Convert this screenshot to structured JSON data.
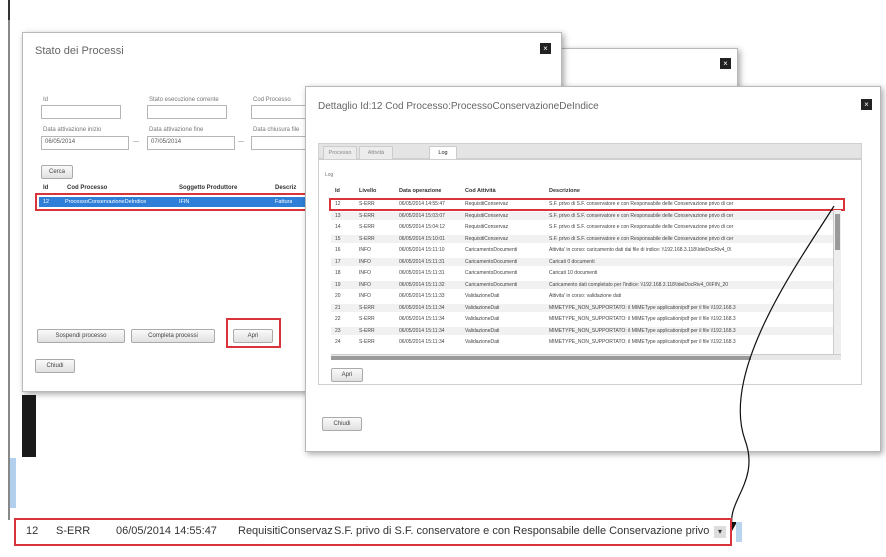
{
  "main_dialog": {
    "title": "Stato dei Processi",
    "close": "×",
    "fields": {
      "id_label": "Id",
      "stato_label": "Stato esecuzione corrente",
      "cod_label": "Cod Processo",
      "data_inizio_label": "Data attivazione inizio",
      "data_inizio_value": "06/05/2014",
      "data_fine_label": "Data attivazione fine",
      "data_fine_value": "07/05/2014",
      "data_chiusura_label": "Data chiusura file"
    },
    "search_button": "Cerca",
    "table": {
      "headers": [
        "Id",
        "Cod Processo",
        "Soggetto Produttore",
        "Descriz"
      ],
      "selected_row": [
        "12",
        "ProcessoConservazioneDeIndice",
        "IFIN",
        "Fattura"
      ]
    },
    "buttons": {
      "suspend": "Sospendi processo",
      "complete": "Completa processi",
      "open": "Apri",
      "close": "Chiudi"
    }
  },
  "detail_dialog": {
    "title": "Dettaglio Id:12 Cod Processo:ProcessoConservazioneDeIndice",
    "close": "×",
    "tabs": [
      "Processo",
      "Attività",
      "Log"
    ],
    "active_tab": "Log",
    "section_label": "Log",
    "headers": [
      "Id",
      "Livello",
      "Data operazione",
      "Cod Attività",
      "Descrizione"
    ],
    "rows": [
      [
        "12",
        "S-ERR",
        "06/05/2014 14:55:47",
        "RequisitiConservaz",
        "S.F. privo di S.F. conservatore e con Responsabile delle Conservazione privo di cer"
      ],
      [
        "13",
        "S-ERR",
        "06/05/2014 15:03:07",
        "RequisitiConservaz",
        "S.F. privo di S.F. conservatore e con Responsabile delle Conservazione privo di cer"
      ],
      [
        "14",
        "S-ERR",
        "06/05/2014 15:04:12",
        "RequisitiConservaz",
        "S.F. privo di S.F. conservatore e con Responsabile delle Conservazione privo di cer"
      ],
      [
        "15",
        "S-ERR",
        "06/05/2014 15:10:01",
        "RequisitiConservaz",
        "S.F. privo di S.F. conservatore e con Responsabile delle Conservazione privo di cer"
      ],
      [
        "16",
        "INFO",
        "06/05/2014 15:11:10",
        "CaricamentoDocumenti",
        "Attivita' in corso: caricamento dati dai file di indice: \\\\192.168.3.118\\IdeiDocRiv4_0\\"
      ],
      [
        "17",
        "INFO",
        "06/05/2014 15:11:31",
        "CaricamentoDocumenti",
        "Caricati 0 documenti"
      ],
      [
        "18",
        "INFO",
        "06/05/2014 15:11:31",
        "CaricamentoDocumenti",
        "Caricati 10 documenti"
      ],
      [
        "19",
        "INFO",
        "06/05/2014 15:11:32",
        "CaricamentoDocumenti",
        "Caricamento dati completato per l'indice: \\\\192.168.3.118\\IdeiDocRiv4_0\\IFIN_20"
      ],
      [
        "20",
        "INFO",
        "06/05/2014 15:11:33",
        "ValidazioneDati",
        "Attivita' in corso: validazione dati"
      ],
      [
        "21",
        "S-ERR",
        "06/05/2014 15:11:34",
        "ValidazioneDati",
        "MIMETYPE_NON_SUPPORTATO: il MIMEType application/pdf per il file \\\\192.168.3"
      ],
      [
        "22",
        "S-ERR",
        "06/05/2014 15:11:34",
        "ValidazioneDati",
        "MIMETYPE_NON_SUPPORTATO: il MIMEType application/pdf per il file \\\\192.168.3"
      ],
      [
        "23",
        "S-ERR",
        "06/05/2014 15:11:34",
        "ValidazioneDati",
        "MIMETYPE_NON_SUPPORTATO: il MIMEType application/pdf per il file \\\\192.168.3"
      ],
      [
        "24",
        "S-ERR",
        "06/05/2014 15:11:34",
        "ValidazioneDati",
        "MIMETYPE_NON_SUPPORTATO: il MIMEType application/pdf per il file \\\\192.168.3"
      ]
    ],
    "open_button": "Apri",
    "close_button": "Chiudi"
  },
  "zoomed_row": {
    "id": "12",
    "level": "S-ERR",
    "date": "06/05/2014 14:55:47",
    "activity": "RequisitiConservaz",
    "description": "S.F. privo di S.F. conservatore e con Responsabile delle Conservazione privo di cer"
  },
  "colors": {
    "highlight_red": "#d9343b",
    "selection_blue": "#2f7fd8"
  }
}
